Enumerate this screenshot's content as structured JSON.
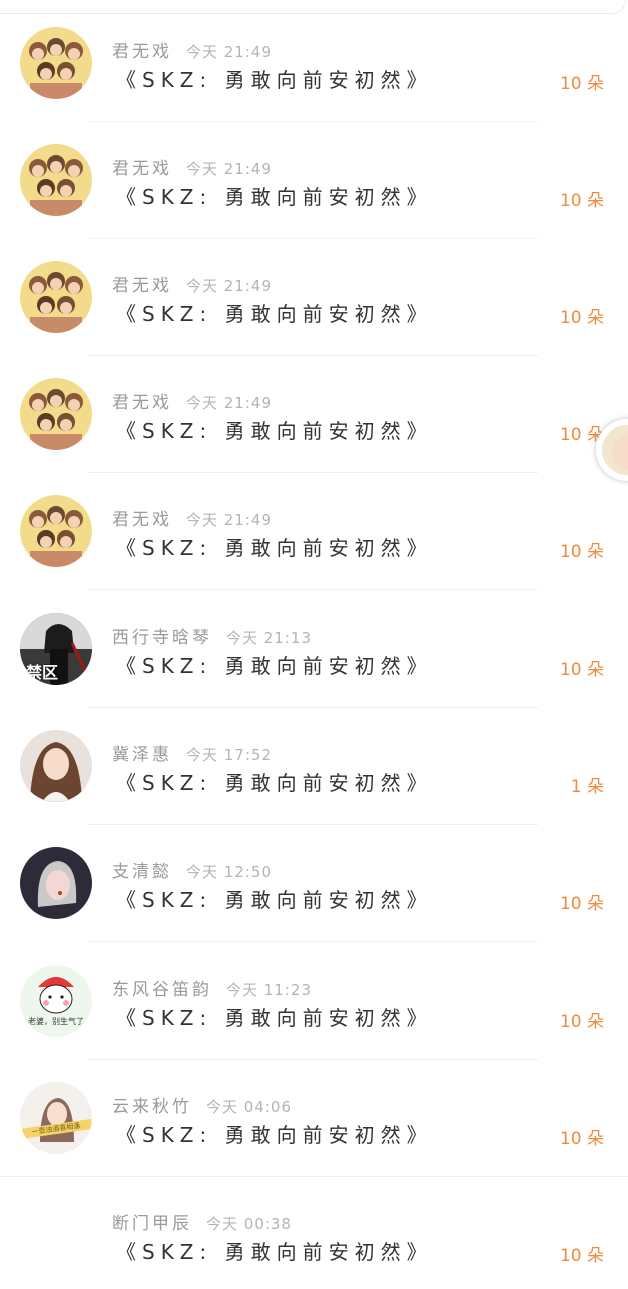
{
  "colors": {
    "amount": "#f08a3c",
    "name": "#9a9a9a",
    "time": "#b4b4b4",
    "title": "#333333"
  },
  "items": [
    {
      "name": "君无戏",
      "time": "今天 21:49",
      "title": "《SKZ: 勇敢向前安初然》",
      "amount": "10 朵",
      "avatar": "cartoon-group-avatar"
    },
    {
      "name": "君无戏",
      "time": "今天 21:49",
      "title": "《SKZ: 勇敢向前安初然》",
      "amount": "10 朵",
      "avatar": "cartoon-group-avatar"
    },
    {
      "name": "君无戏",
      "time": "今天 21:49",
      "title": "《SKZ: 勇敢向前安初然》",
      "amount": "10 朵",
      "avatar": "cartoon-group-avatar"
    },
    {
      "name": "君无戏",
      "time": "今天 21:49",
      "title": "《SKZ: 勇敢向前安初然》",
      "amount": "10 朵",
      "avatar": "cartoon-group-avatar"
    },
    {
      "name": "君无戏",
      "time": "今天 21:49",
      "title": "《SKZ: 勇敢向前安初然》",
      "amount": "10 朵",
      "avatar": "cartoon-group-avatar"
    },
    {
      "name": "西行寺晗琴",
      "time": "今天 21:13",
      "title": "《SKZ: 勇敢向前安初然》",
      "amount": "10 朵",
      "avatar": "dark-portrait-avatar",
      "avatar_text": "禁区"
    },
    {
      "name": "冀泽惠",
      "time": "今天 17:52",
      "title": "《SKZ: 勇敢向前安初然》",
      "amount": "1 朵",
      "avatar": "girl-photo-avatar"
    },
    {
      "name": "支清懿",
      "time": "今天 12:50",
      "title": "《SKZ: 勇敢向前安初然》",
      "amount": "10 朵",
      "avatar": "illustrated-girl-avatar"
    },
    {
      "name": "东风谷笛韵",
      "time": "今天 11:23",
      "title": "《SKZ: 勇敢向前安初然》",
      "amount": "10 朵",
      "avatar": "cartoon-face-avatar",
      "avatar_text": "老婆，别生气了"
    },
    {
      "name": "云来秋竹",
      "time": "今天 04:06",
      "title": "《SKZ: 勇敢向前安初然》",
      "amount": "10 朵",
      "avatar": "banner-photo-avatar",
      "avatar_text": "一壶浊酒喜相逢"
    },
    {
      "name": "断门甲辰",
      "time": "今天 00:38",
      "title": "《SKZ: 勇敢向前安初然》",
      "amount": "10 朵",
      "avatar": "none"
    }
  ],
  "floating_avatar": "floating-user-avatar"
}
